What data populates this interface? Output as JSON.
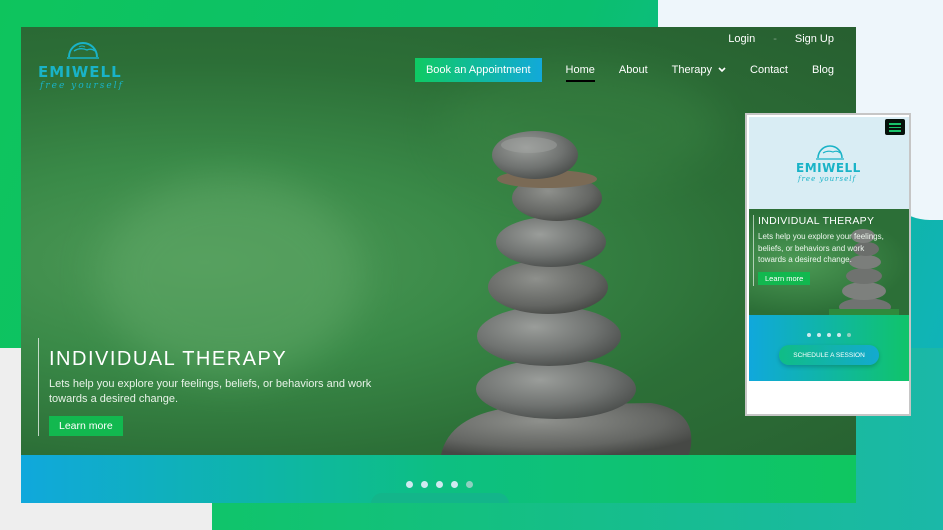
{
  "brand": {
    "name": "EMIWELL",
    "tagline": "free yourself"
  },
  "top_links": {
    "login": "Login",
    "signup": "Sign Up"
  },
  "nav": {
    "book": "Book an Appointment",
    "home": "Home",
    "about": "About",
    "therapy": "Therapy",
    "contact": "Contact",
    "blog": "Blog"
  },
  "hero": {
    "title": "INDIVIDUAL THERAPY",
    "text": "Lets help you explore your feelings, beliefs, or behaviors and work towards a desired change.",
    "button": "Learn more"
  },
  "slider": {
    "count": 5,
    "active": 1
  },
  "mobile": {
    "brand": "EMIWELL",
    "tagline": "free yourself",
    "title": "INDIVIDUAL THERAPY",
    "text": "Lets help you explore your feelings, beliefs, or behaviors and work towards a desired change.",
    "button": "Learn more",
    "cta": "SCHEDULE A SESSION"
  },
  "icons": {
    "dropdown": "chevron-down-icon",
    "menu": "hamburger-menu-icon",
    "logo": "sunrise-logo-icon"
  },
  "colors": {
    "brand": "#19b3c7",
    "accent_green": "#12b84f",
    "accent_blue": "#12a9d9"
  }
}
